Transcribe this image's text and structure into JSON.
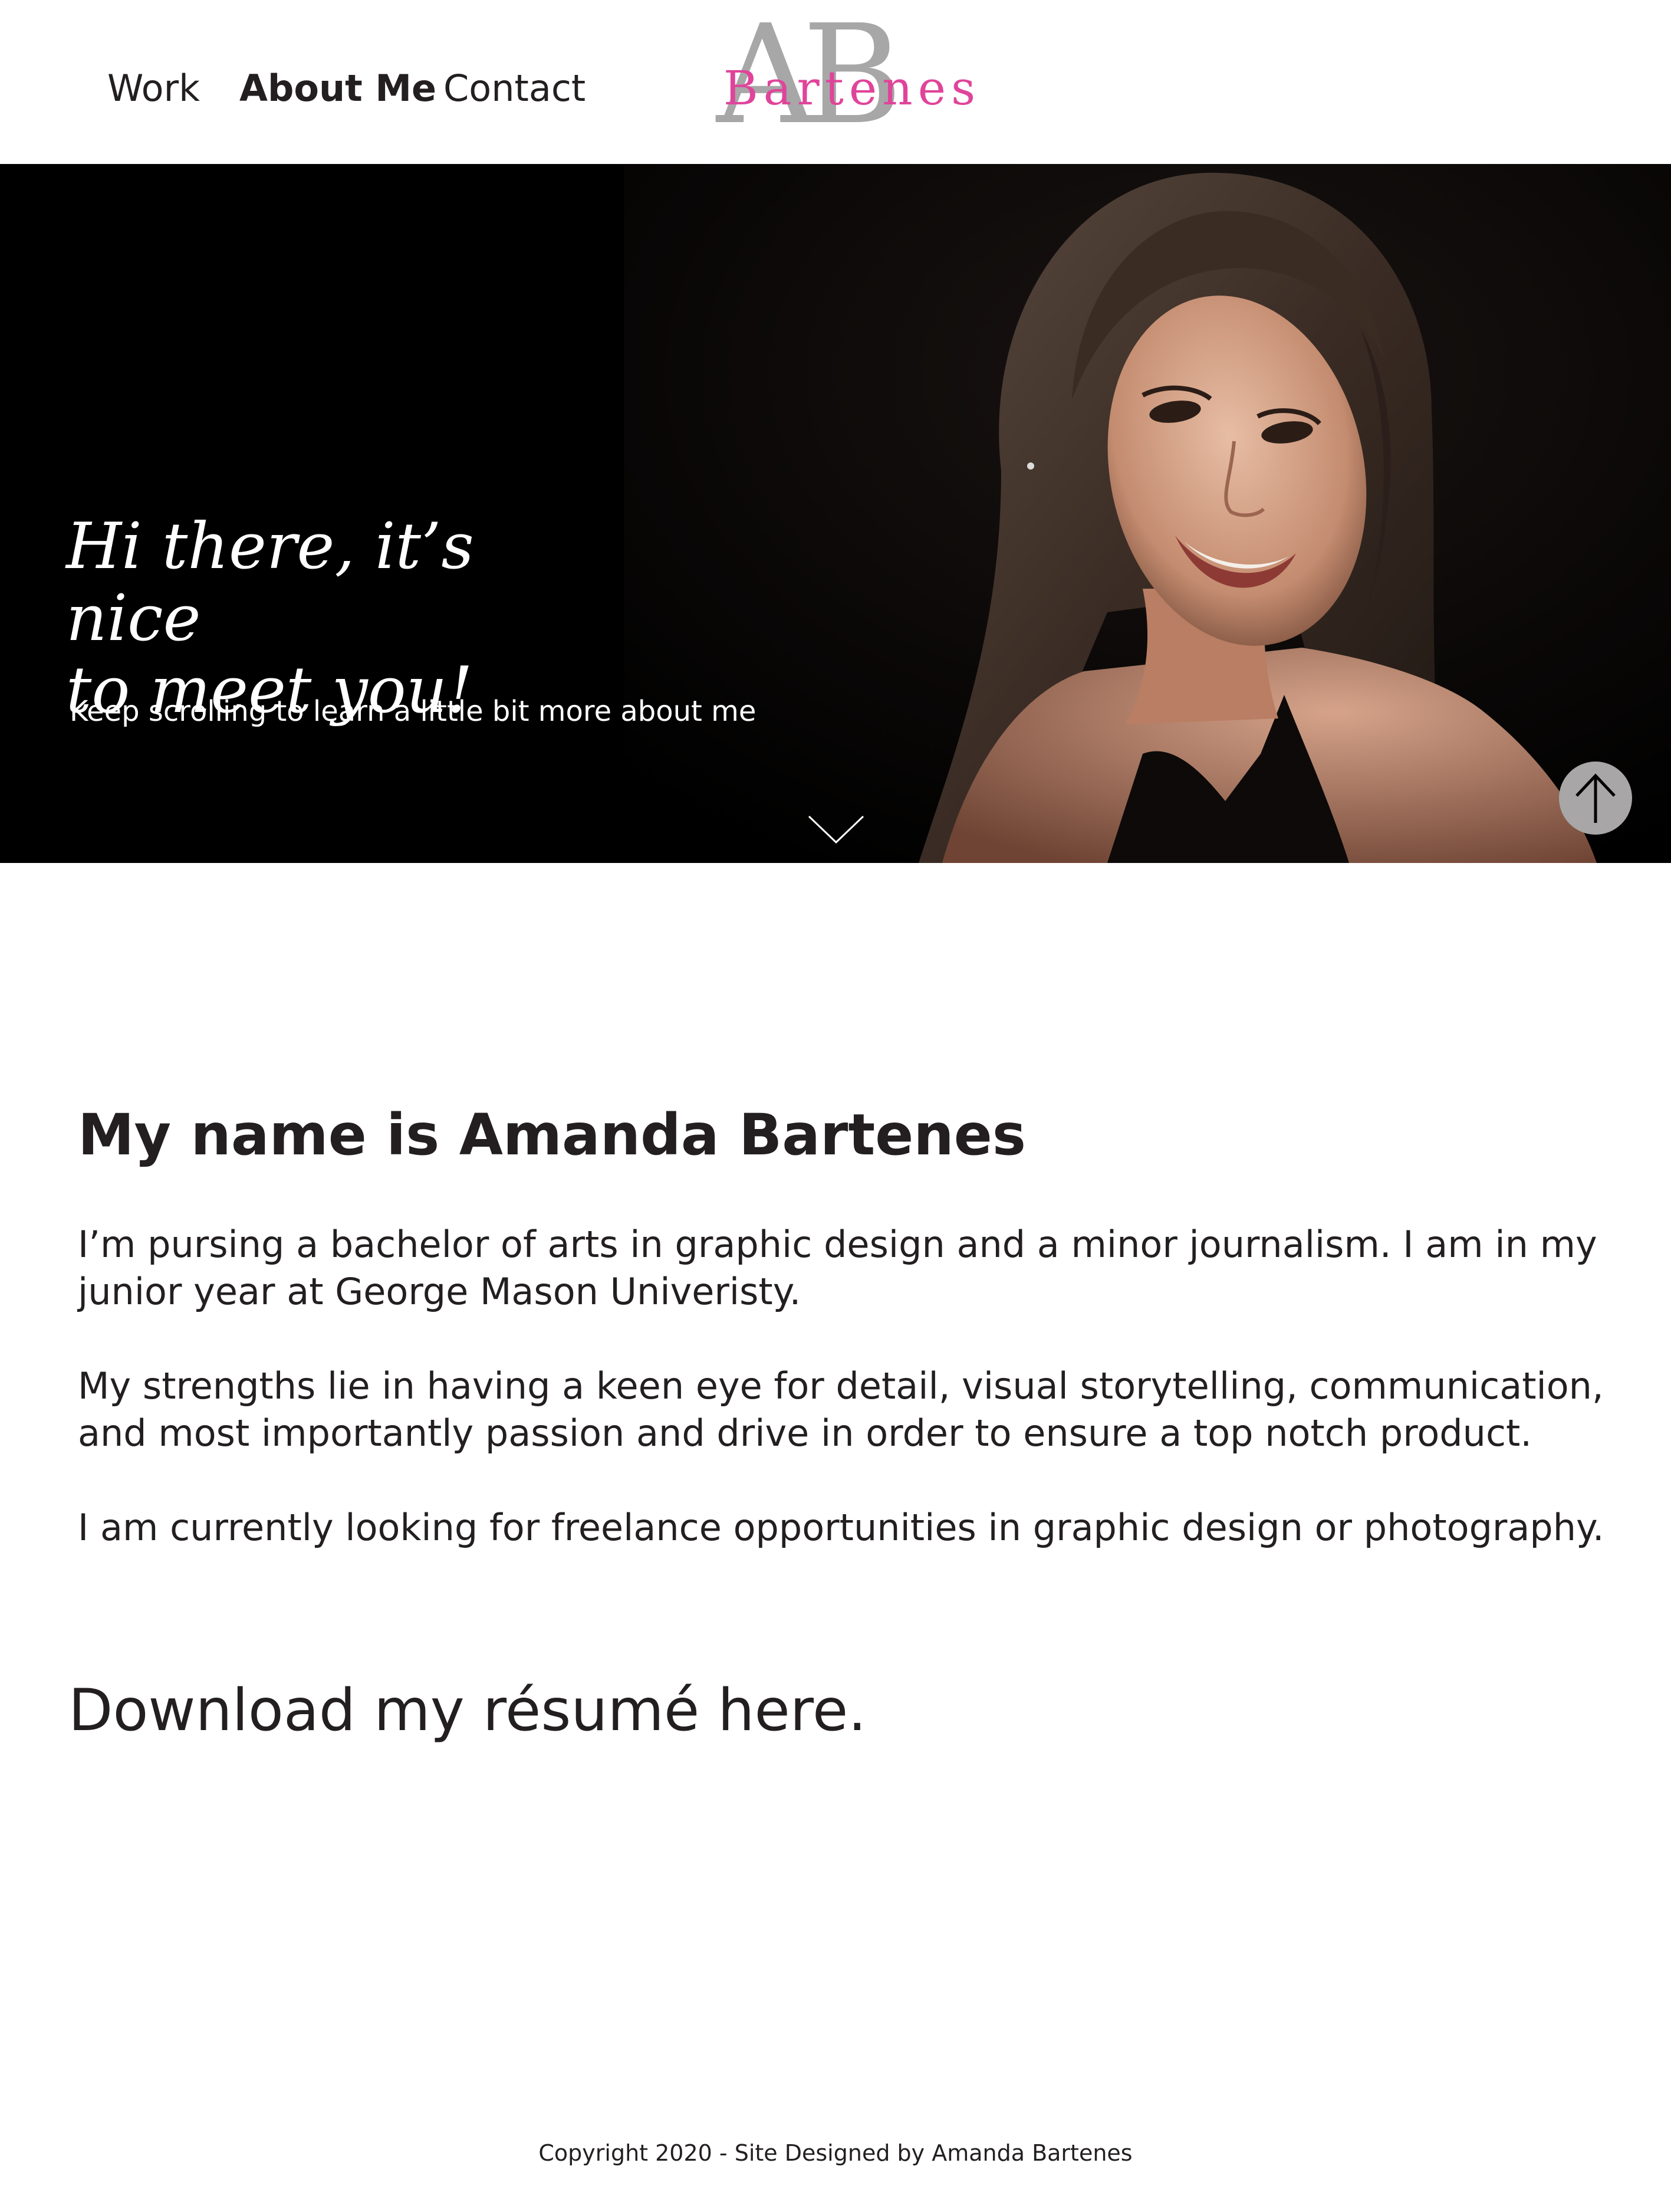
{
  "nav": {
    "work": "Work",
    "about": "About Me",
    "contact": "Contact",
    "active": "About Me"
  },
  "logo": {
    "initials": "AB",
    "name": "Bartenes",
    "initials_color": "#a7a7a7",
    "name_color": "#e0449a"
  },
  "hero": {
    "greeting": "Hi there, it’s nice\nto meet you!",
    "subtitle": "Keep scrolling to learn a little bit more about me",
    "scroll_icon": "chevron-down-icon",
    "top_icon": "arrow-up-icon",
    "top_button_color": "#a8a6a6"
  },
  "about": {
    "heading": "My name is Amanda Bartenes",
    "paragraphs": [
      "I’m pursing a bachelor of arts in graphic design and a minor journalism. I am in my\njunior year at George Mason Univeristy.",
      "My strengths lie in having a keen eye for detail, visual storytelling, communication,\nand most importantly passion and drive in order to ensure a top notch product.",
      "I am currently looking for freelance opportunities in graphic design or photography."
    ],
    "resume_link": "Download my résumé here."
  },
  "footer": {
    "copyright": "Copyright 2020 - Site Designed by Amanda Bartenes"
  }
}
